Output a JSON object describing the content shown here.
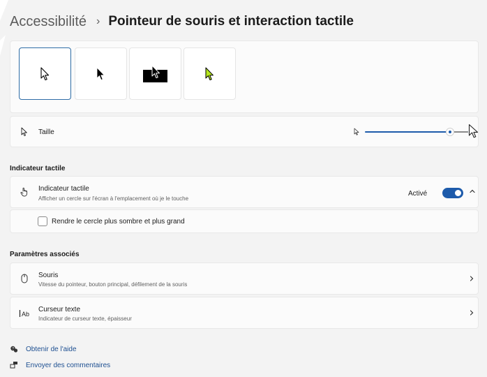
{
  "header": {
    "parent": "Accessibilité",
    "separator": "›",
    "title": "Pointeur de souris et interaction tactile"
  },
  "pointer_styles": {
    "selected_index": 0,
    "tiles": [
      {
        "name": "white",
        "color": "#ffffff"
      },
      {
        "name": "black",
        "color": "#000000"
      },
      {
        "name": "inverted",
        "color": "#000000"
      },
      {
        "name": "custom",
        "color": "#b5e61d"
      }
    ]
  },
  "size": {
    "label": "Taille",
    "value_fraction": 0.86
  },
  "touch_section": {
    "title": "Indicateur tactile",
    "item": {
      "label": "Indicateur tactile",
      "description": "Afficher un cercle sur l'écran à l'emplacement où je le touche",
      "state": "Activé",
      "toggle_on": true
    },
    "checkbox_label": "Rendre le cercle plus sombre et plus grand",
    "checkbox_checked": false
  },
  "related_section": {
    "title": "Paramètres associés",
    "items": [
      {
        "label": "Souris",
        "description": "Vitesse du pointeur, bouton principal, défilement de la souris"
      },
      {
        "label": "Curseur texte",
        "description": "Indicateur de curseur texte, épaisseur"
      }
    ]
  },
  "footer": {
    "help_label": "Obtenir de l'aide",
    "feedback_label": "Envoyer des commentaires"
  },
  "colors": {
    "accent": "#1d5bab",
    "background": "#f3f3f3",
    "card": "#fbfbfb"
  }
}
